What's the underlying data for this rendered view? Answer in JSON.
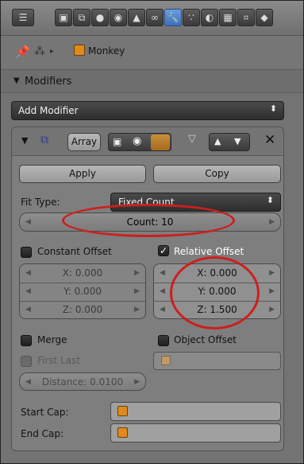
{
  "header": {
    "tabs": [
      "render-tab",
      "render-layers-tab",
      "scene-tab",
      "world-tab",
      "object-tab",
      "constraints-tab",
      "modifiers-tab",
      "particles-tab",
      "physics-tab",
      "texture-tab",
      "scene-extra-tab"
    ],
    "active_tab": "modifiers-tab"
  },
  "context": {
    "object_name": "Monkey"
  },
  "modifiers_panel": {
    "title": "Modifiers",
    "add_modifier_label": "Add Modifier"
  },
  "array_modifier": {
    "name": "Array",
    "apply_label": "Apply",
    "copy_label": "Copy",
    "fit_type_label": "Fit Type:",
    "fit_type_value": "Fixed Count",
    "count_text": "Count: 10",
    "constant_offset": {
      "label": "Constant Offset",
      "checked": false,
      "x": "X: 0.000",
      "y": "Y: 0.000",
      "z": "Z: 0.000"
    },
    "relative_offset": {
      "label": "Relative Offset",
      "checked": true,
      "x": "X: 0.000",
      "y": "Y: 0.000",
      "z": "Z: 1.500"
    },
    "merge_label": "Merge",
    "first_last_label": "First Last",
    "distance_text": "Distance: 0.0100",
    "object_offset_label": "Object Offset",
    "start_cap_label": "Start Cap:",
    "end_cap_label": "End Cap:"
  },
  "colors": {
    "highlight_ring": "#cc1f1f",
    "active_tab": "#4f81c9",
    "panel_bg": "#737373"
  }
}
